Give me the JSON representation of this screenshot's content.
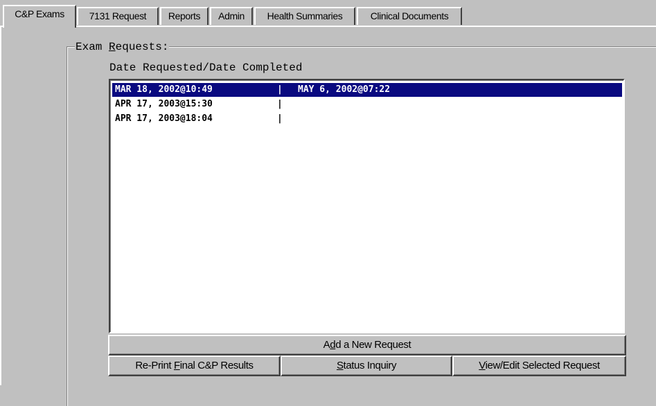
{
  "tabs": [
    {
      "label": "C&P Exams",
      "active": true
    },
    {
      "label": "7131 Request",
      "active": false
    },
    {
      "label": "Reports",
      "active": false
    },
    {
      "label": "Admin",
      "active": false
    },
    {
      "label": "Health Summaries",
      "active": false
    },
    {
      "label": "Clinical Documents",
      "active": false
    }
  ],
  "group": {
    "title_prefix": "Exam ",
    "title_mnemonic": "R",
    "title_suffix": "equests:"
  },
  "list": {
    "header": "Date Requested/Date Completed",
    "separator": "|",
    "rows": [
      {
        "requested": "MAR 18, 2002@10:49",
        "completed": "MAY 6, 2002@07:22",
        "selected": true
      },
      {
        "requested": "APR 17, 2003@15:30",
        "completed": "",
        "selected": false
      },
      {
        "requested": "APR 17, 2003@18:04",
        "completed": "",
        "selected": false
      }
    ]
  },
  "buttons": {
    "add_new": {
      "pre": "A",
      "mnemonic": "d",
      "post": "d a New Request"
    },
    "reprint": {
      "pre": "Re-Print ",
      "mnemonic": "F",
      "post": "inal C&P Results"
    },
    "status": {
      "pre": "",
      "mnemonic": "S",
      "post": "tatus Inquiry"
    },
    "view_edit": {
      "pre": "",
      "mnemonic": "V",
      "post": "iew/Edit Selected Request"
    }
  },
  "colors": {
    "face": "#c0c0c0",
    "selection": "#0a0a80",
    "list_background": "#ffffff"
  }
}
